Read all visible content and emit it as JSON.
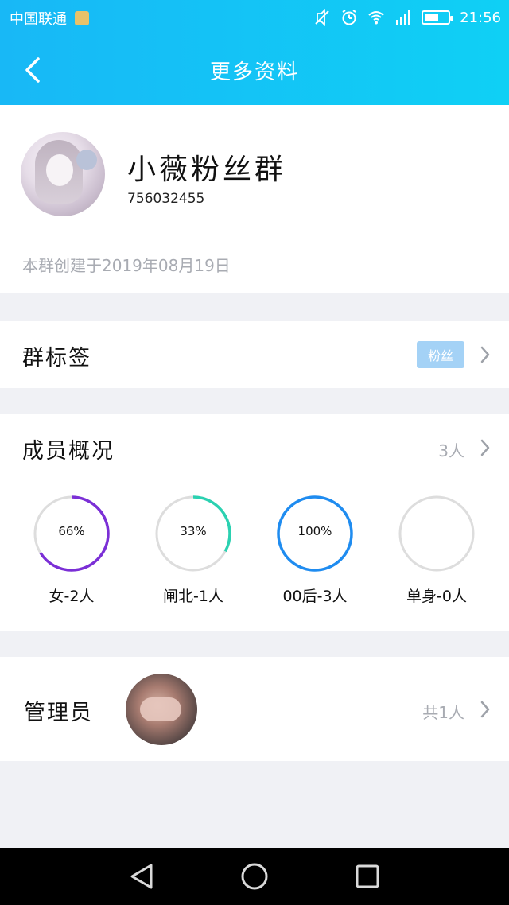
{
  "status_bar": {
    "carrier": "中国联通",
    "time": "21:56",
    "battery_level_pct": 60
  },
  "header": {
    "title": "更多资料"
  },
  "group": {
    "name": "小薇粉丝群",
    "id": "756032455",
    "created": "本群创建于2019年08月19日"
  },
  "tags_row": {
    "label": "群标签",
    "tag": "粉丝"
  },
  "members": {
    "label": "成员概况",
    "count": "3人",
    "stats": [
      {
        "percent": 66,
        "percent_text": "66%",
        "label": "女-2人",
        "color": "#7b2fd6"
      },
      {
        "percent": 33,
        "percent_text": "33%",
        "label": "闸北-1人",
        "color": "#2bd1b1"
      },
      {
        "percent": 100,
        "percent_text": "100%",
        "label": "00后-3人",
        "color": "#1f8cf0"
      },
      {
        "percent": 0,
        "percent_text": "",
        "label": "单身-0人",
        "color": "#dddddd"
      }
    ]
  },
  "admin": {
    "label": "管理员",
    "count": "共1人"
  },
  "colors": {
    "header_start": "#18b8f6",
    "header_end": "#0fd0f5",
    "tag_chip": "#a4d2f6",
    "secondary_text": "#a8abb2",
    "background": "#f0f1f5"
  }
}
